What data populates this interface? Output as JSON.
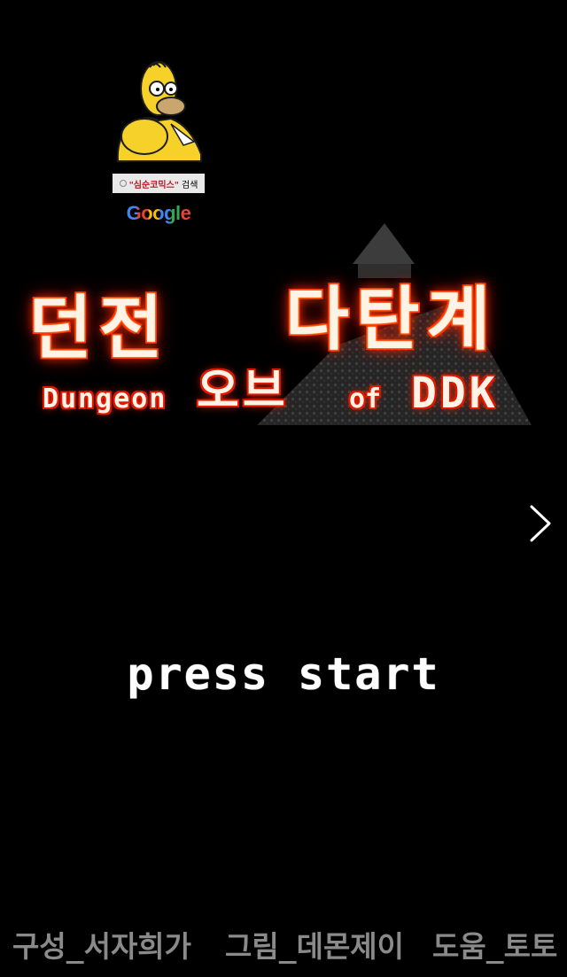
{
  "promo_badge": {
    "brand_text": "Google",
    "search_query": "\"심순코믹스\"",
    "search_suffix": "검색"
  },
  "title": {
    "word_1": "던전",
    "word_2": "다탄계",
    "word_3": "오브",
    "en_dungeon": "Dungeon",
    "en_of": "of",
    "en_ddk": "DDK"
  },
  "prompt": {
    "press_start": "press start"
  },
  "credits": {
    "composition": "구성_서자희가",
    "art": "그림_데몬제이",
    "assist": "도움_토토"
  },
  "icons": {
    "next": "chevron-right-icon",
    "mascot": "homer-mascot-icon",
    "pyramid": "pyramid-icon"
  },
  "colors": {
    "background": "#000000",
    "fire": "#ff2a00",
    "title_fill": "#fff3e6",
    "credits": "#8a8a8a"
  }
}
